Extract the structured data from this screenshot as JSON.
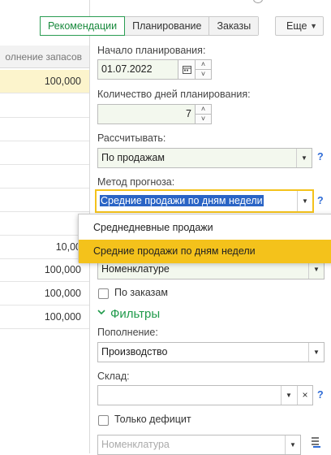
{
  "left_table": {
    "header": "олнение запасов",
    "rows": [
      {
        "value": "100,000",
        "selected": true
      },
      {
        "value": ""
      },
      {
        "value": ""
      },
      {
        "value": ""
      },
      {
        "value": ""
      },
      {
        "value": ""
      },
      {
        "value": ""
      },
      {
        "value": "10,00"
      },
      {
        "value": "100,000"
      },
      {
        "value": "100,000"
      },
      {
        "value": "100,000"
      }
    ]
  },
  "tabs": [
    {
      "label": "Рекомендации",
      "active": true
    },
    {
      "label": "Планирование",
      "active": false
    },
    {
      "label": "Заказы",
      "active": false
    }
  ],
  "more_button": {
    "label": "Еще"
  },
  "form": {
    "start_label": "Начало планирования:",
    "start_value": "01.07.2022",
    "days_label": "Количество дней планирования:",
    "days_value": "7",
    "calc_label": "Рассчитывать:",
    "calc_value": "По продажам",
    "method_label": "Метод прогноза:",
    "method_value": "Средние продажи по дням недели",
    "group_value": "Номенклатуре",
    "by_orders_label": "По заказам",
    "filters_label": "Фильтры",
    "replenish_label": "Пополнение:",
    "replenish_value": "Производство",
    "warehouse_label": "Склад:",
    "warehouse_value": "",
    "deficit_label": "Только дефицит",
    "nomenclature_placeholder": "Номенклатура",
    "help_mark": "?"
  },
  "dropdown": {
    "options": [
      {
        "label": "Среднедневные продажи",
        "highlighted": false
      },
      {
        "label": "Средние продажи по дням недели",
        "highlighted": true
      }
    ]
  },
  "colors": {
    "accent_green": "#2a9d52",
    "highlight_yellow": "#f4c21b",
    "selected_row": "#fcf4cc",
    "help_blue": "#2e6bd6"
  }
}
